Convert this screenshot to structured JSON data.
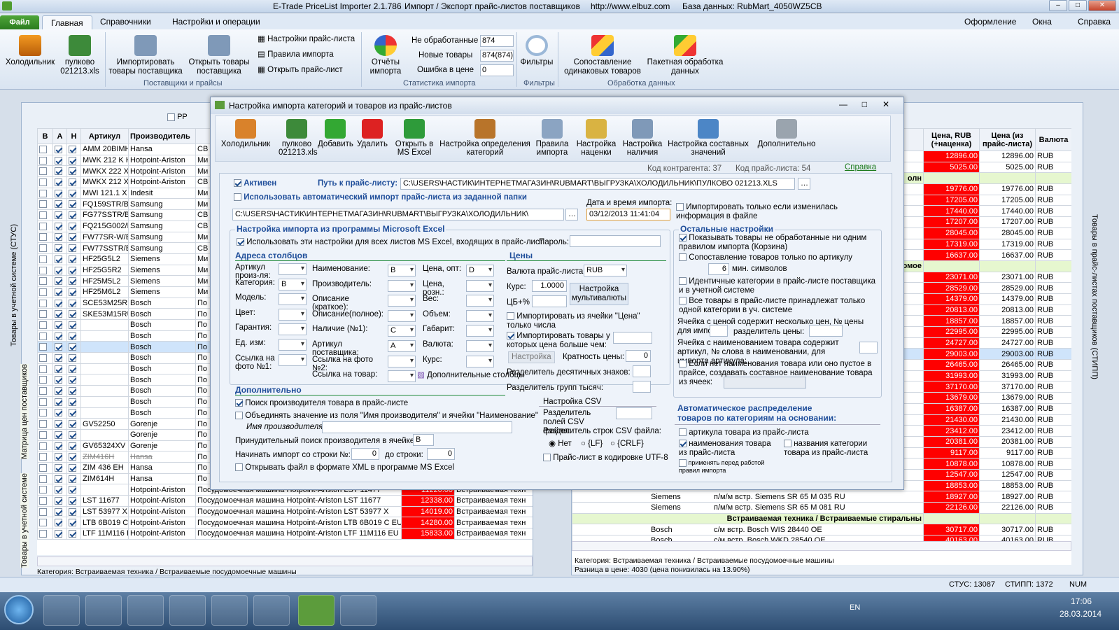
{
  "window": {
    "title": "E-Trade PriceList Importer 2.1.786",
    "subtitle": "Импорт / Экспорт прайс-листов поставщиков",
    "url": "http://www.elbuz.com",
    "db": "База данных: RubMart_4050WZ5CB"
  },
  "tabs": {
    "file": "Файл",
    "main": "Главная",
    "refs": "Справочники",
    "settings": "Настройки и операции",
    "right": [
      "Оформление",
      "Окна",
      "Справка"
    ]
  },
  "ribbon": {
    "fridge": "Холодильник",
    "pulkovo": "пулково 021213.xls",
    "import_goods": "Импортировать товары поставщика",
    "open_goods": "Открыть товары поставщика",
    "pl_settings": "Настройки прайс-листа",
    "import_rules": "Правила импорта",
    "open_pl": "Открыть прайс-лист",
    "reports": "Отчёты импорта",
    "filters": "Фильтры",
    "compare": "Сопоставление одинаковых товаров",
    "batch": "Пакетная обработка данных",
    "grp_supp": "Поставщики и прайсы",
    "grp_stat": "Статистика импорта",
    "grp_filt": "Фильтры",
    "grp_proc": "Обработка данных",
    "stats": [
      {
        "l": "Не обработанные",
        "v": "874"
      },
      {
        "l": "Новые товары",
        "v": "874(874)"
      },
      {
        "l": "Ошибка в цене",
        "v": "0"
      }
    ]
  },
  "left": {
    "headers": [
      "В",
      "А",
      "Н",
      "Артикул",
      "Производитель"
    ],
    "pp": "PP",
    "side1": "Товары в учетной системе (СТУС)",
    "side2": "Матрица цен поставщиков",
    "side3": "Товары в учетной системе",
    "rows": [
      [
        "AMM 20BIMH",
        "Hansa",
        "СВ"
      ],
      [
        "MWK 212 K HA",
        "Hotpoint-Ariston",
        "Ми"
      ],
      [
        "MWKX 222 X H",
        "Hotpoint-Ariston",
        "Ми"
      ],
      [
        "MWKX 212 X",
        "Hotpoint-Ariston",
        "СВ"
      ],
      [
        "MWI 121.1 X",
        "Indesit",
        "Ми"
      ],
      [
        "FQ159STR/BW",
        "Samsung",
        "Ми"
      ],
      [
        "FG77SSTR/BW",
        "Samsung",
        "СВ"
      ],
      [
        "FQ215G002/B",
        "Samsung",
        "СВ"
      ],
      [
        "FW77SR-W/BW",
        "Samsung",
        "Ми"
      ],
      [
        "FW77SSTR/BW",
        "Samsung",
        "СВ"
      ],
      [
        "HF25G5L2",
        "Siemens",
        "Ми"
      ],
      [
        "HF25G5R2",
        "Siemens",
        "Ми"
      ],
      [
        "HF25M5L2",
        "Siemens",
        "Ми"
      ],
      [
        "HF25M6L2",
        "Siemens",
        "Ми"
      ],
      [
        "SCE53M25RU",
        "Bosch",
        "По"
      ],
      [
        "SKE53M15RU",
        "Bosch",
        "По"
      ],
      [
        "",
        "Bosch",
        "По"
      ],
      [
        "",
        "Bosch",
        "По"
      ],
      [
        "",
        "Bosch",
        "По"
      ],
      [
        "",
        "Bosch",
        "По"
      ],
      [
        "",
        "Bosch",
        "По"
      ],
      [
        "",
        "Bosch",
        "По"
      ],
      [
        "",
        "Bosch",
        "По"
      ],
      [
        "",
        "Bosch",
        "По"
      ],
      [
        "",
        "Bosch",
        "По"
      ],
      [
        "GV52250",
        "Gorenje",
        "По"
      ],
      [
        "",
        "Gorenje",
        "По"
      ],
      [
        "GV65324XV",
        "Gorenje",
        "По"
      ],
      [
        "ZIM416H",
        "Hansa",
        "По"
      ],
      [
        "ZIM 436 EH",
        "Hansa",
        "По"
      ],
      [
        "ZIM614H",
        "Hansa",
        "По"
      ]
    ],
    "rows2": [
      [
        "",
        "Hotpoint-Ariston",
        "Посудомоечная машина Hotpoint-Ariston LST 11477",
        "11220.00",
        "Встраиваемая техн"
      ],
      [
        "LST 11677",
        "Hotpoint-Ariston",
        "Посудомоечная машина Hotpoint-Ariston LST 11677",
        "12338.00",
        "Встраиваемая техн"
      ],
      [
        "LST 53977 X",
        "Hotpoint-Ariston",
        "Посудомоечная машина Hotpoint-Ariston LST 53977 X",
        "14019.00",
        "Встраиваемая техн"
      ],
      [
        "LTB 6B019 C E",
        "Hotpoint-Ariston",
        "Посудомоечная машина Hotpoint-Ariston LTB 6B019 C EU",
        "14280.00",
        "Встраиваемая техн"
      ],
      [
        "LTF 11M116 E",
        "Hotpoint-Ariston",
        "Посудомоечная машина Hotpoint-Ariston LTF 11M116 EU",
        "15833.00",
        "Встраиваемая техн"
      ]
    ],
    "category": "Категория: Встраиваемая техника / Встраиваемые посудомоечные машины"
  },
  "right": {
    "headers": [
      "Цена, RUB (+наценка)",
      "Цена (из прайс-листа)",
      "Валюта"
    ],
    "side": "Товары в прайс-листах поставщиков (СТИПП)",
    "prices": [
      [
        "12896.00",
        "12896.00",
        "RUB"
      ],
      [
        "5025.00",
        "5025.00",
        "RUB"
      ],
      [
        "",
        "",
        ""
      ],
      [
        "19776.00",
        "19776.00",
        "RUB"
      ],
      [
        "17205.00",
        "17205.00",
        "RUB"
      ],
      [
        "17440.00",
        "17440.00",
        "RUB"
      ],
      [
        "17207.00",
        "17207.00",
        "RUB"
      ],
      [
        "28045.00",
        "28045.00",
        "RUB"
      ],
      [
        "17319.00",
        "17319.00",
        "RUB"
      ],
      [
        "16637.00",
        "16637.00",
        "RUB"
      ],
      [
        "",
        "",
        ""
      ],
      [
        "23071.00",
        "23071.00",
        "RUB"
      ],
      [
        "28529.00",
        "28529.00",
        "RUB"
      ],
      [
        "14379.00",
        "14379.00",
        "RUB"
      ],
      [
        "20813.00",
        "20813.00",
        "RUB"
      ],
      [
        "18857.00",
        "18857.00",
        "RUB"
      ],
      [
        "22995.00",
        "22995.00",
        "RUB"
      ],
      [
        "24727.00",
        "24727.00",
        "RUB"
      ],
      [
        "29003.00",
        "29003.00",
        "RUB"
      ],
      [
        "26465.00",
        "26465.00",
        "RUB"
      ],
      [
        "31993.00",
        "31993.00",
        "RUB"
      ],
      [
        "37170.00",
        "37170.00",
        "RUB"
      ],
      [
        "13679.00",
        "13679.00",
        "RUB"
      ],
      [
        "16387.00",
        "16387.00",
        "RUB"
      ],
      [
        "21430.00",
        "21430.00",
        "RUB"
      ],
      [
        "23412.00",
        "23412.00",
        "RUB"
      ],
      [
        "20381.00",
        "20381.00",
        "RUB"
      ],
      [
        "9117.00",
        "9117.00",
        "RUB"
      ],
      [
        "10878.00",
        "10878.00",
        "RUB"
      ],
      [
        "12547.00",
        "12547.00",
        "RUB"
      ],
      [
        "18853.00",
        "18853.00",
        "RUB"
      ],
      [
        "18927.00",
        "18927.00",
        "RUB"
      ],
      [
        "22126.00",
        "22126.00",
        "RUB"
      ],
      [
        "",
        "",
        ""
      ],
      [
        "30717.00",
        "30717.00",
        "RUB"
      ],
      [
        "40163.00",
        "40163.00",
        "RUB"
      ]
    ],
    "frag1": "олн",
    "frag2": "омое",
    "bottom": [
      [
        "Siemens",
        "п/м/м встр. Siemens SR 65 M 035 RU"
      ],
      [
        "Siemens",
        "п/м/м встр. Siemens SR 65 M 081 RU"
      ],
      [
        "",
        "Встраиваемая техника / Встраиваемые стиральны"
      ],
      [
        "Bosch",
        "с/м встр. Bosch WIS 28440 OE"
      ],
      [
        "Bosch",
        "с/м встр. Bosch WKD 28540 OE"
      ]
    ],
    "category": "Категория: Встраиваемая техника / Встраиваемые посудомоечные машины",
    "diff": "Разница в цене: 4030 (цена понизилась на 13.90%)"
  },
  "dialog": {
    "title": "Настройка импорта категорий и товаров из прайс-листов",
    "tb": [
      "Холодильник",
      "пулково 021213.xls",
      "Добавить",
      "Удалить",
      "Открыть в MS Excel",
      "Настройка определения категорий",
      "Правила импорта",
      "Настройка наценки",
      "Настройка наличия",
      "Настройка составных значений",
      "Дополнительно"
    ],
    "kod_k": "Код контрагента: 37",
    "kod_p": "Код прайс-листа: 54",
    "help": "Справка",
    "active": "Активен",
    "path_label": "Путь к прайс-листу:",
    "path": "C:\\USERS\\НАСТИК\\ИНТЕРНЕТМАГАЗИН\\RUBMART\\ВЫГРУЗКА\\ХОЛОДИЛЬНИК\\ПУЛКОВО 021213.XLS",
    "auto": "Использовать автоматический импорт прайс-листа из заданной папки",
    "folder": "C:\\USERS\\НАСТИК\\ИНТЕРНЕТМАГАЗИН\\RUBMART\\ВЫГРУЗКА\\ХОЛОДИЛЬНИК\\",
    "dt_label": "Дата и время импорта:",
    "dt": "03/12/2013 11:41:04",
    "only_changed": "Импортировать только если изменилась информация в файле",
    "excel_sec": "Настройка импорта из программы Microsoft Excel",
    "use_all": "Использовать эти настройки для всех листов MS Excel, входящих в прайс-лист",
    "pwd": "Пароль:",
    "addr": "Адреса столбцов",
    "prices_sec": "Цены",
    "c1": [
      [
        "Артикул произ-ля:",
        ""
      ],
      [
        "Категория:",
        "B"
      ],
      [
        "Модель:",
        ""
      ],
      [
        "Цвет:",
        ""
      ],
      [
        "Гарантия:",
        ""
      ],
      [
        "Ед. изм:",
        ""
      ],
      [
        "Ссылка на фото №1:",
        ""
      ]
    ],
    "c2": [
      [
        "Наименование:",
        "B"
      ],
      [
        "Производитель:",
        ""
      ],
      [
        "Описание (краткое):",
        ""
      ],
      [
        "Описание(полное):",
        ""
      ],
      [
        "Наличие (№1):",
        "C"
      ],
      [
        "Артикул поставщика:",
        "A"
      ],
      [
        "Ссылка на фото №2:",
        ""
      ],
      [
        "Ссылка на товар:",
        ""
      ]
    ],
    "c3": [
      [
        "Цена, опт:",
        "D"
      ],
      [
        "Цена, розн.:",
        ""
      ],
      [
        "Вес:",
        ""
      ],
      [
        "Объем:",
        ""
      ],
      [
        "Габарит:",
        ""
      ],
      [
        "Валюта:",
        ""
      ],
      [
        "Курс:",
        ""
      ]
    ],
    "cur_label": "Валюта прайс-листа:",
    "cur": "RUB",
    "rate_label": "Курс:",
    "rate": "1.0000",
    "cb_label": "ЦБ+%",
    "multi": "Настройка мультивалюты",
    "only_num": "Импортировать из ячейки \"Цена\" только числа",
    "price_gt": "Импортировать товары у которых цена больше чем:",
    "nastr": "Настройка",
    "krat": "Кратность цены:",
    "krat_v": "0",
    "dec": "Разделитель десятичных знаков:",
    "thou": "Разделитель групп тысяч:",
    "extra_cols": "Дополнительные столбцы",
    "dop": "Дополнительно",
    "find_mfr": "Поиск производителя товара в прайс-листе",
    "merge": "Объединять значение из поля \"Имя производителя\" и ячейки \"Наименование\"",
    "mfr_name": "Имя производителя:",
    "force": "Принудительный поиск производителя в ячейке:",
    "force_v": "B",
    "start": "Начинать импорт со строки №:",
    "start_v": "0",
    "to": "до строки:",
    "to_v": "0",
    "xml": "Открывать файл в формате XML в программе MS Excel",
    "csv": "Настройка CSV",
    "csv_f": "Разделитель полей CSV файла:",
    "csv_r": "Разделитель строк CSV файла:",
    "r_no": "Нет",
    "r_lf": "{LF}",
    "r_crlf": "{CRLF}",
    "utf": "Прайс-лист в кодировке UTF-8",
    "other": "Остальные настройки",
    "o1": "Показывать товары не обработанные ни одним правилом импорта (Корзина)",
    "o2": "Сопоставление товаров только по артикулу",
    "o2v": "6",
    "o2s": "мин. символов",
    "o3": "Идентичные категории в прайс-листе поставщика и в учетной системе",
    "o4": "Все товары в прайс-листе принадлежат только одной категории в уч. системе",
    "o5": "Ячейка с ценой содержит несколько цен, № цены для импорта:",
    "o5b": "разделитель цены:",
    "o6": "Ячейка с наименованием товара содержит артикул, № слова в наименовании, для импорта артикула:",
    "o7": "Если нет наименования товара или оно пустое в прайсе, создавать составное наименование товара из ячеек:",
    "auto_sec": "Автоматическое распределение товаров по категориям на основании:",
    "a1": "артикула товара из прайс-листа",
    "a2": "наименования товара из прайс-листа",
    "a3": "названия категории товара из прайс-листа",
    "a4": "применять перед работой правил импорта"
  },
  "status": {
    "stus": "СТУС: 13087",
    "stipp": "СТИПП: 1372",
    "num": "NUM"
  },
  "taskbar": {
    "lang": "EN",
    "time": "17:06",
    "date": "28.03.2014"
  },
  "colors": {
    "red": "#ff0000",
    "green": "#e6f7cf",
    "blue": "#1f4e9a"
  }
}
